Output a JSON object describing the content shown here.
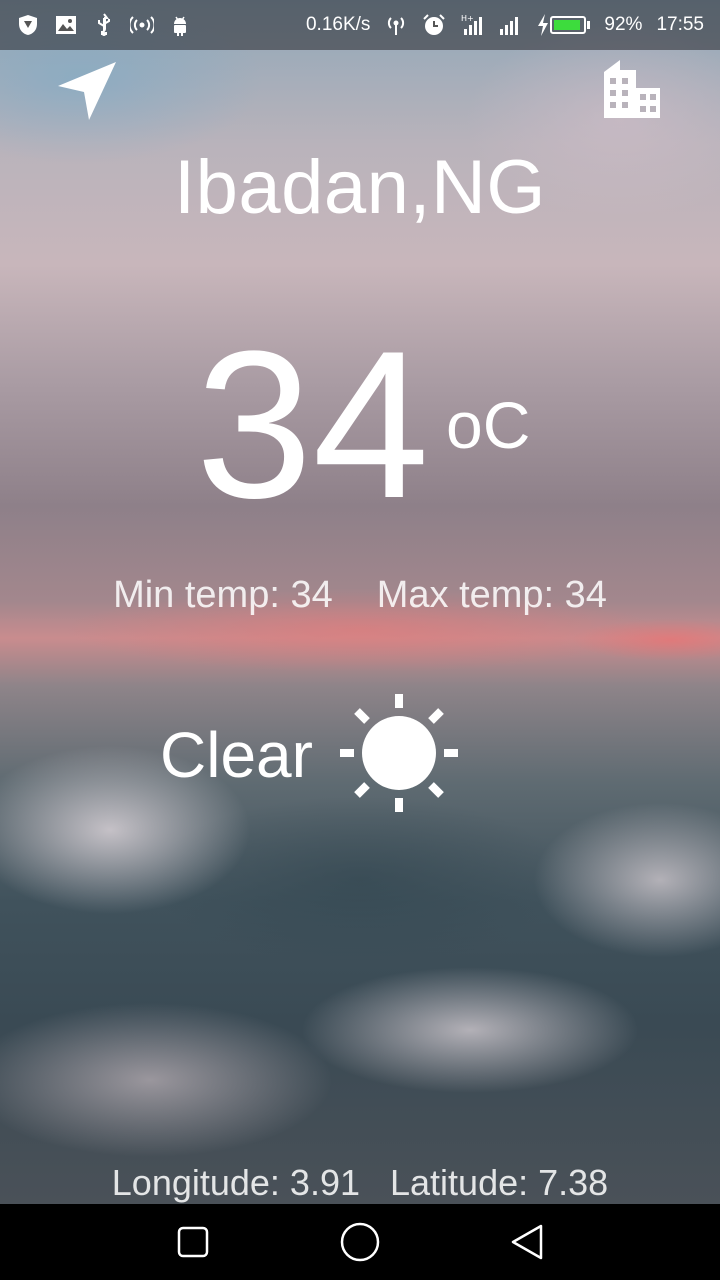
{
  "status_bar": {
    "net_speed": "0.16K/s",
    "battery_percent": "92%",
    "battery_level": 0.92,
    "time": "17:55",
    "left_icons": [
      "shield-icon",
      "image-icon",
      "usb-icon",
      "hotspot-icon",
      "android-icon"
    ],
    "right_icons": [
      "wifi-hotspot-icon",
      "alarm-icon",
      "signal-hplus-icon",
      "signal-icon",
      "charging-icon",
      "battery-icon"
    ],
    "battery_color": "#3ddc3d"
  },
  "header": {
    "location_icon": "navigation-arrow-icon",
    "city_icon": "city-building-icon"
  },
  "weather": {
    "city": "Ibadan,NG",
    "temperature": "34",
    "unit": "oC",
    "min_temp": "Min temp: 34",
    "max_temp": "Max temp: 34",
    "condition": "Clear",
    "condition_icon": "sun-icon"
  },
  "coordinates": {
    "longitude": "Longitude: 3.91",
    "latitude": "Latitude: 7.38"
  },
  "nav_bar": {
    "icons": [
      "recents-square-icon",
      "home-circle-icon",
      "back-triangle-icon"
    ]
  }
}
